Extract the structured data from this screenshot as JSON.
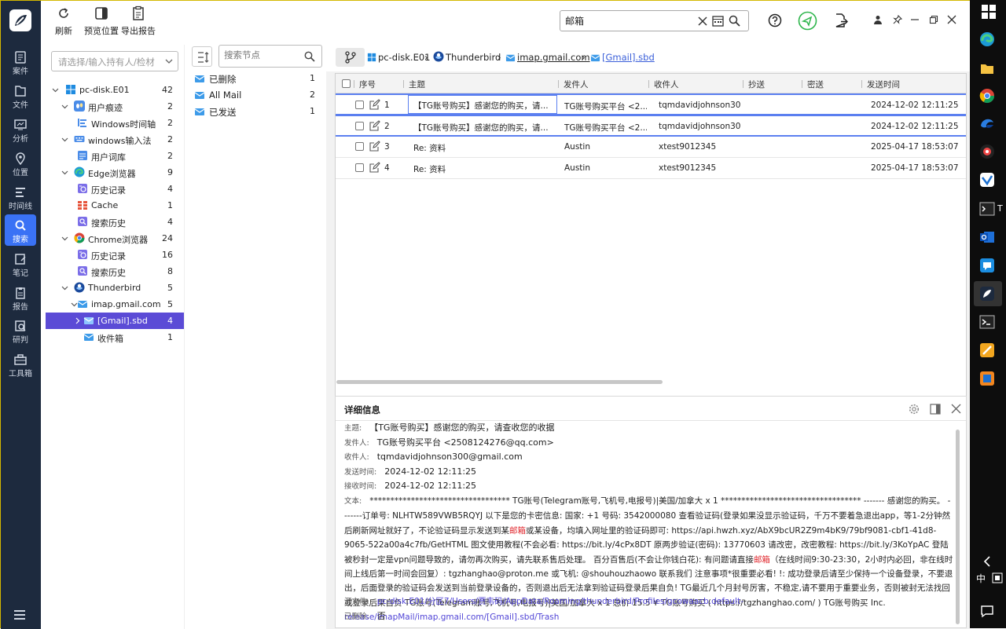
{
  "sidebar": {
    "items": [
      {
        "label": "案件",
        "icon": "case-icon"
      },
      {
        "label": "文件",
        "icon": "file-icon"
      },
      {
        "label": "分析",
        "icon": "analysis-icon"
      },
      {
        "label": "位置",
        "icon": "location-icon"
      },
      {
        "label": "时间线",
        "icon": "timeline-icon"
      },
      {
        "label": "搜索",
        "icon": "search-icon",
        "active": true
      },
      {
        "label": "笔记",
        "icon": "note-icon"
      },
      {
        "label": "报告",
        "icon": "report-icon"
      },
      {
        "label": "研判",
        "icon": "judge-icon"
      },
      {
        "label": "工具箱",
        "icon": "toolbox-icon"
      }
    ]
  },
  "toolbar": {
    "refresh_label": "刷新",
    "preview_label": "预览位置",
    "export_label": "导出报告",
    "search_value": "邮箱"
  },
  "case_select": {
    "placeholder": "请选择/输入持有人/检材"
  },
  "tree": [
    {
      "label": "pc-disk.E01",
      "count": "42"
    },
    {
      "label": "用户痕迹",
      "count": "2"
    },
    {
      "label": "Windows时间轴",
      "count": "2"
    },
    {
      "label": "windows输入法",
      "count": "2"
    },
    {
      "label": "用户词库",
      "count": "2"
    },
    {
      "label": "Edge浏览器",
      "count": "9"
    },
    {
      "label": "历史记录",
      "count": "4"
    },
    {
      "label": "Cache",
      "count": "1"
    },
    {
      "label": "搜索历史",
      "count": "4"
    },
    {
      "label": "Chrome浏览器",
      "count": "24"
    },
    {
      "label": "历史记录",
      "count": "16"
    },
    {
      "label": "搜索历史",
      "count": "8"
    },
    {
      "label": "Thunderbird",
      "count": "5"
    },
    {
      "label": "imap.gmail.com",
      "count": "5"
    },
    {
      "label": "[Gmail].sbd",
      "count": "4"
    },
    {
      "label": "收件箱",
      "count": "1"
    }
  ],
  "node_search": {
    "placeholder": "搜索节点"
  },
  "nodes": [
    {
      "label": "已删除",
      "count": "1"
    },
    {
      "label": "All Mail",
      "count": "2"
    },
    {
      "label": "已发送",
      "count": "1"
    }
  ],
  "breadcrumb": [
    "pc-disk.E01",
    "Thunderbird",
    "imap.gmail.com",
    "[Gmail].sbd"
  ],
  "grid": {
    "headers": [
      "序号",
      "主题",
      "发件人",
      "收件人",
      "抄送",
      "密送",
      "发送时间"
    ],
    "rows": [
      {
        "no": "1",
        "subject": "【TG账号购买】感谢您的购买，请...",
        "from": "TG账号购买平台 <2...",
        "to": "tqmdavidjohnson30...",
        "time": "2024-12-02 12:11:25"
      },
      {
        "no": "2",
        "subject": "【TG账号购买】感谢您的购买，请...",
        "from": "TG账号购买平台 <2...",
        "to": "tqmdavidjohnson30...",
        "time": "2024-12-02 12:11:25"
      },
      {
        "no": "3",
        "subject": "Re: 资料",
        "from": "Austin",
        "to": "xtest9012345",
        "time": "2025-04-17 18:53:07"
      },
      {
        "no": "4",
        "subject": "Re: 资料",
        "from": "Austin",
        "to": "xtest9012345",
        "time": "2025-04-17 18:53:07"
      }
    ]
  },
  "details": {
    "title": "详细信息",
    "subject_label": "主题:",
    "subject": "【TG账号购买】感谢您的购买，请查收您的收据",
    "from_label": "发件人:",
    "from": "TG账号购买平台 <2508124276@qq.com>",
    "to_label": "收件人:",
    "to": "tqmdavidjohnson300@gmail.com",
    "sent_label": "发送时间:",
    "sent": "2024-12-02 12:11:25",
    "recv_label": "接收时间:",
    "recv": "2024-12-02 12:11:25",
    "body_label": "文本:",
    "body_a": "********************************** TG账号(Telegram账号,飞机号,电报号)|美国/加拿大 x 1 ********************************** ------- 感谢您的购买。 -------订单号: NLHTW589VWB5RQYJ 以下是您的卡密信息: 国家: +1 号码: 3542000080 查看验证码(登录如果没显示验证码，千万不要着急退出app，等1-2分钟然后刷新网址就好了，不论验证码显示发送到某",
    "hit1": "邮箱",
    "body_b": "或某设备，均填入网址里的验证码即可: https://api.hwzh.xyz/AbX9bcUR2Z9m4bK9/79bf9081-cbf1-41d8-9065-522a00a4c7fb/GetHTML 图文使用教程(不会必看: https://bit.ly/4cPx8DT 原两步验证(密码): 13770603 请改密，改密教程: https://bit.ly/3KoYpAC 登陆被秒封一定是vpn问题导致的，请勿再次购买，请先联系售后处理。 百分百售后(不会让你钱白花): 有问题请直接",
    "hit2": "邮箱",
    "body_c": "（在线时间9:30-23:30，2小时内必回，非在线时间上线后第一时间会回复）: tgzhanghao@proton.me 或飞机: @shouhouzhaowo 联系我们 注意事项*很重要必看! !: 成功登录后请至少保持一个设备登录，不要退出，后面登录的验证码会发送到当前登录设备的，否则退出后无法拿到验证码登录后果自负! TG最近几个月封号厉害，不稳定,请不要用于重要业务，否则被封无法找回或登录后果自负 TG账号(Telegram账号,飞机号,电报号)|美国/加拿大 x 1 总价 15.5 ¥ TG账号购买 ( https://tgzhanghao.com/ ) TG账号购买 Inc.",
    "source_label": "源文件:",
    "source": "pc-disk.E01/分区7/Users/贾韦码/AppData/Roaming/thunderbird/Profiles/gcowaacb.default-release/ImapMail/imap.gmail.com/[Gmail].sbd/Trash",
    "deleted_label": "已删除:",
    "deleted": "否"
  },
  "taskbar": {
    "term_label": "T",
    "ime_label": "中"
  },
  "colors": {
    "accent": "#3a72f5",
    "selected": "#5b4bd6",
    "hit": "#e0262c",
    "link": "#5145d6"
  }
}
